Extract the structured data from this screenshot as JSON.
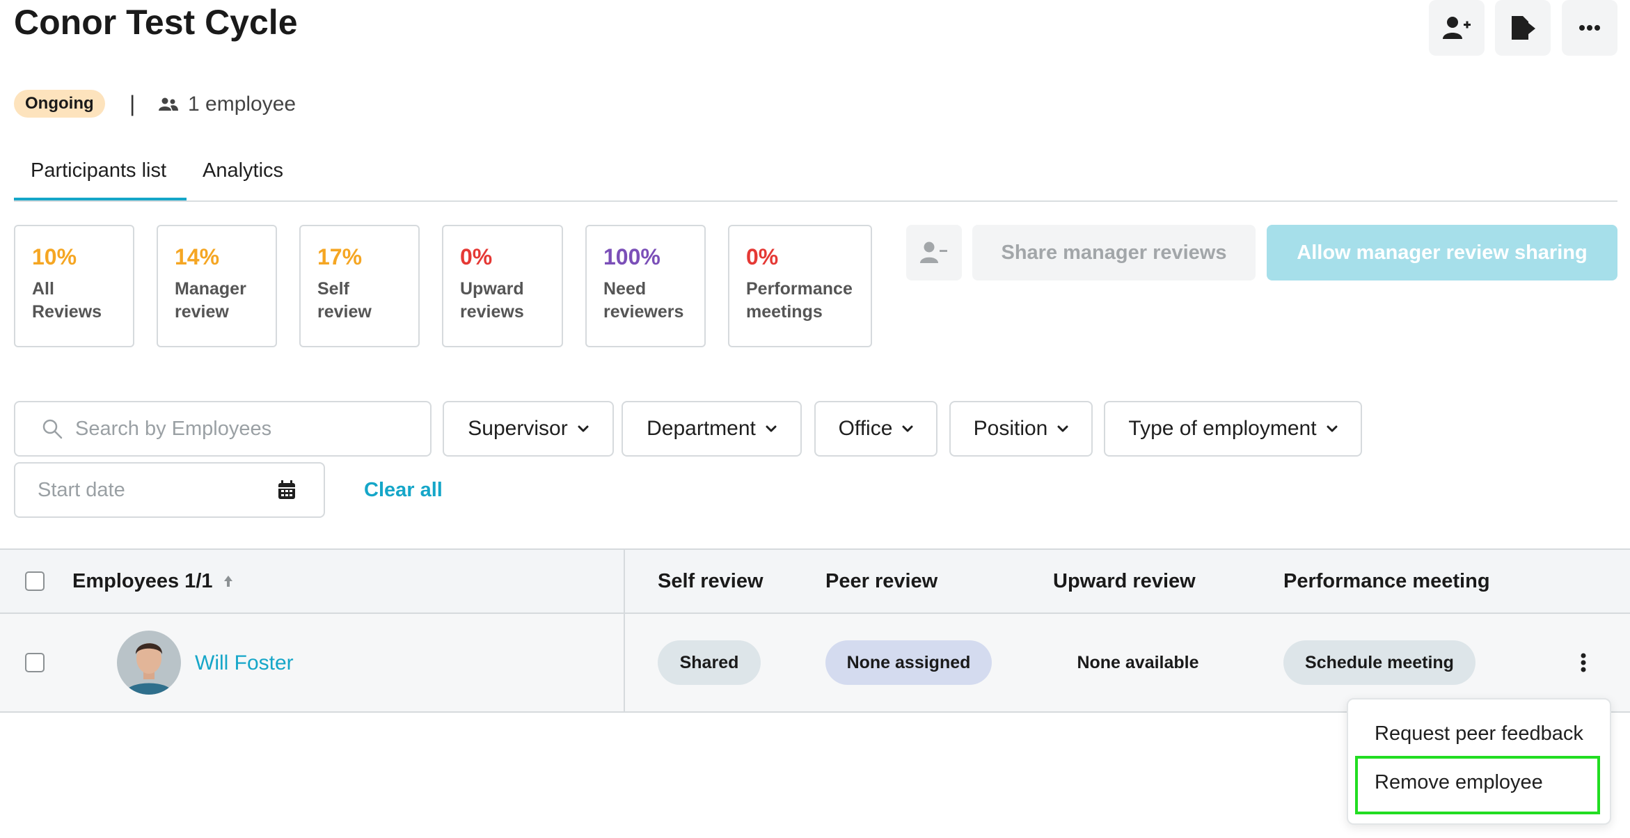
{
  "header": {
    "title": "Conor Test Cycle",
    "status_badge": "Ongoing",
    "separator": "|",
    "employee_count": "1 employee"
  },
  "tabs": [
    {
      "label": "Participants list",
      "active": true
    },
    {
      "label": "Analytics",
      "active": false
    }
  ],
  "stats": [
    {
      "pct": "10%",
      "label_line1": "All",
      "label_line2": "Reviews",
      "color": "#f5a623"
    },
    {
      "pct": "14%",
      "label_line1": "Manager",
      "label_line2": "review",
      "color": "#f5a623"
    },
    {
      "pct": "17%",
      "label_line1": "Self",
      "label_line2": "review",
      "color": "#f5a623"
    },
    {
      "pct": "0%",
      "label_line1": "Upward",
      "label_line2": "reviews",
      "color": "#e53935"
    },
    {
      "pct": "100%",
      "label_line1": "Need",
      "label_line2": "reviewers",
      "color": "#7b4fb8"
    },
    {
      "pct": "0%",
      "label_line1": "Performance",
      "label_line2": "meetings",
      "color": "#e53935"
    }
  ],
  "actions": {
    "share_manager_reviews": "Share manager reviews",
    "allow_manager_review_sharing": "Allow manager review sharing"
  },
  "filters": {
    "search_placeholder": "Search by Employees",
    "supervisor": "Supervisor",
    "department": "Department",
    "office": "Office",
    "position": "Position",
    "type_of_employment": "Type of employment",
    "start_date_placeholder": "Start date",
    "clear_all": "Clear all"
  },
  "table": {
    "headers": {
      "employees": "Employees 1/1",
      "self_review": "Self review",
      "peer_review": "Peer review",
      "upward_review": "Upward review",
      "performance_meeting": "Performance meeting"
    },
    "rows": [
      {
        "name": "Will Foster",
        "self_review": "Shared",
        "peer_review": "None assigned",
        "upward_review": "None available",
        "performance_meeting": "Schedule meeting"
      }
    ]
  },
  "row_menu": {
    "items": [
      "Request peer feedback",
      "Remove employee"
    ]
  },
  "colors": {
    "accent": "#15a6c8",
    "highlight": "#22dd22"
  }
}
